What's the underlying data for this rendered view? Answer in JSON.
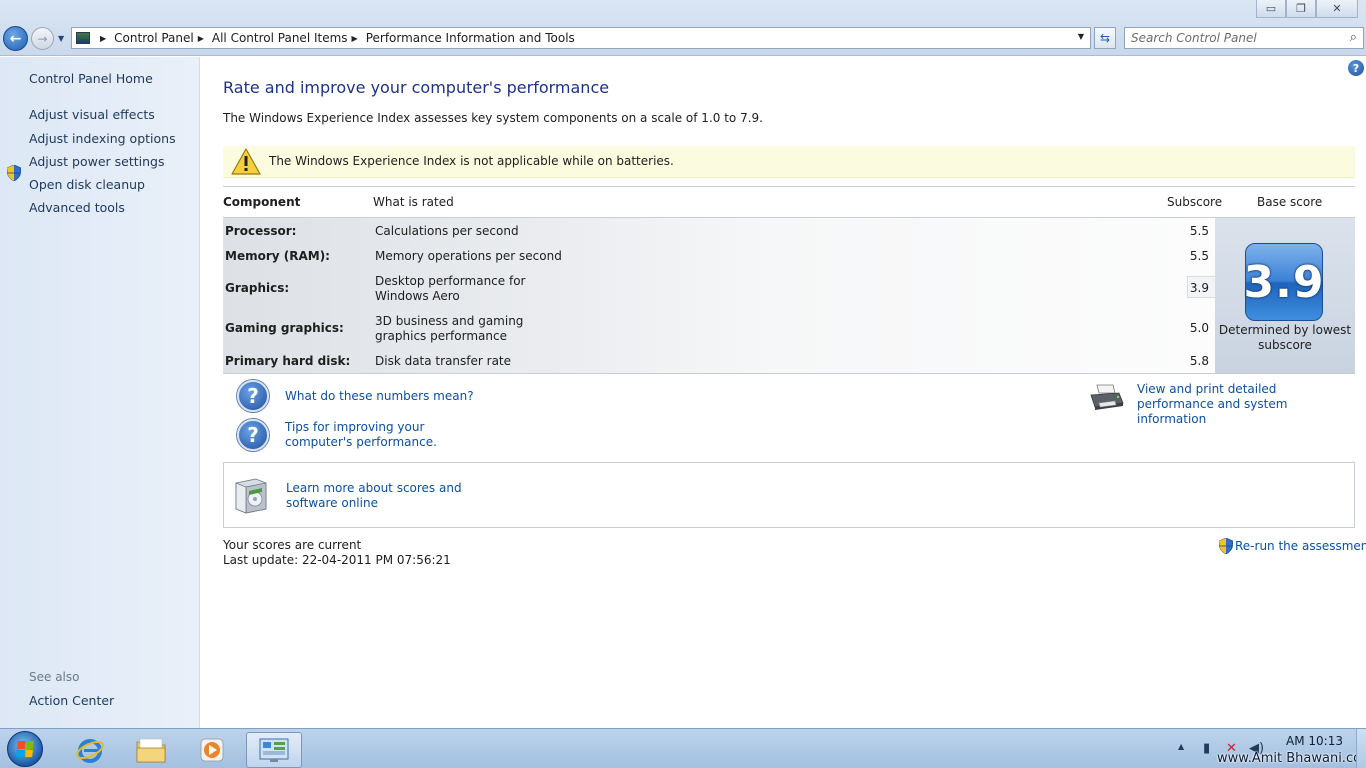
{
  "window": {
    "minimize_glyph": "▭",
    "restore_glyph": "❐",
    "close_glyph": "✕"
  },
  "nav": {
    "back_glyph": "←",
    "forward_glyph": "→"
  },
  "address": {
    "crumbs": [
      "Control Panel",
      "All Control Panel Items",
      "Performance Information and Tools"
    ]
  },
  "search": {
    "placeholder": "Search Control Panel"
  },
  "left_pane": {
    "home_label": "Control Panel Home",
    "tasks": [
      "Adjust visual effects",
      "Adjust indexing options",
      "Adjust power settings",
      "Open disk cleanup",
      "Advanced tools"
    ],
    "see_also_label": "See also",
    "see_also_items": [
      "Action Center"
    ]
  },
  "main": {
    "title": "Rate and improve your computer's performance",
    "intro": "The Windows Experience Index assesses key system components on a scale of 1.0 to 7.9.",
    "warning": "The Windows Experience Index is not applicable while on batteries.",
    "table": {
      "headers": {
        "component": "Component",
        "what": "What is rated",
        "subscore": "Subscore",
        "base": "Base score"
      },
      "rows": [
        {
          "component": "Processor:",
          "what": "Calculations per second",
          "subscore": "5.5"
        },
        {
          "component": "Memory (RAM):",
          "what": "Memory operations per second",
          "subscore": "5.5"
        },
        {
          "component": "Graphics:",
          "what": "Desktop performance for Windows Aero",
          "subscore": "3.9"
        },
        {
          "component": "Gaming graphics:",
          "what": "3D business and gaming graphics performance",
          "subscore": "5.0"
        },
        {
          "component": "Primary hard disk:",
          "what": "Disk data transfer rate",
          "subscore": "5.8"
        }
      ],
      "base_score": "3.9",
      "base_caption": "Determined by lowest subscore"
    },
    "links": {
      "numbers_meaning": "What do these numbers mean?",
      "tips": "Tips for improving your computer's performance.",
      "print_details": "View and print detailed performance and system information",
      "learn_more": "Learn more about scores and software online",
      "rerun": "Re-run the assessment"
    },
    "status": {
      "current": "Your scores are current",
      "last_update": "Last update: 22-04-2011 PM 07:56:21"
    }
  },
  "taskbar": {
    "clock_time": "AM 10:13",
    "watermark": "www.Amit Bhawani.com"
  },
  "colors": {
    "link": "#0c50a0",
    "title": "#1e3287",
    "warning_bg": "#fbfbe0"
  }
}
